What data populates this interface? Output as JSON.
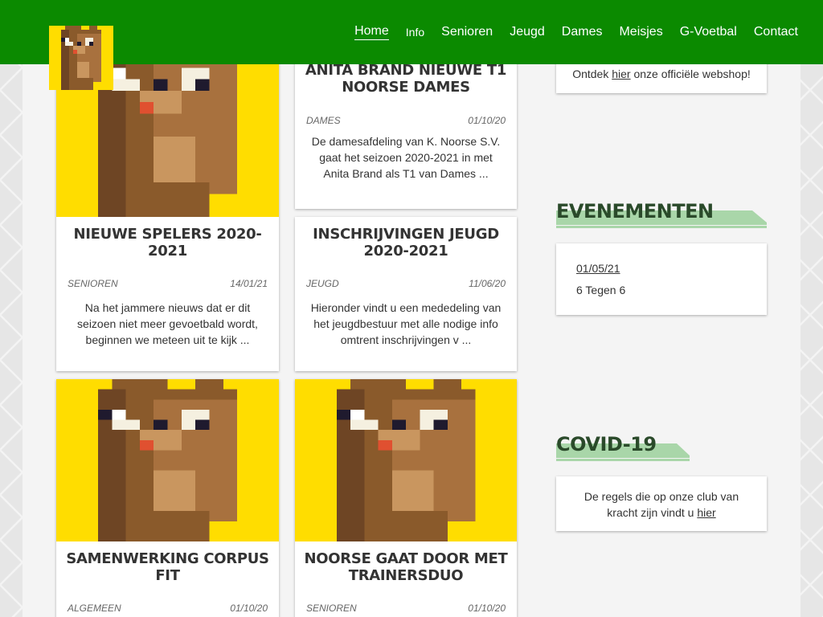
{
  "colors": {
    "header_bg": "#0b8a00",
    "logo_bg": "#ffdd00",
    "accent_underline": "#a9d6a9"
  },
  "nav": {
    "items": [
      {
        "label": "Home",
        "active": true
      },
      {
        "label": "Info"
      },
      {
        "label": "Senioren"
      },
      {
        "label": "Jeugd"
      },
      {
        "label": "Dames"
      },
      {
        "label": "Meisjes"
      },
      {
        "label": "G-Voetbal"
      },
      {
        "label": "Contact"
      }
    ]
  },
  "logo": {
    "icon": "pixel-beaver-logo"
  },
  "posts": [
    {
      "title": "ANITA BRAND NIEUWE T1 NOORSE DAMES",
      "category": "DAMES",
      "date": "01/10/20",
      "excerpt": "De damesafdeling van K. Noorse S.V. gaat het seizoen 2020-2021 in met Anita Brand als T1 van Dames ..."
    },
    {
      "title": "NIEUWE SPELERS 2020-2021",
      "category": "SENIOREN",
      "date": "14/01/21",
      "excerpt": "Na het jammere nieuws dat er dit seizoen niet meer gevoetbald wordt, beginnen we meteen uit te kijk ..."
    },
    {
      "title": "INSCHRIJVINGEN JEUGD 2020-2021",
      "category": "JEUGD",
      "date": "11/06/20",
      "excerpt": "Hieronder vindt u een mededeling van het jeugdbestuur met alle nodige info omtrent inschrijvingen v ..."
    },
    {
      "title": "SAMENWERKING CORPUS FIT",
      "category": "ALGEMEEN",
      "date": "01/10/20"
    },
    {
      "title": "NOORSE GAAT DOOR MET TRAINERSDUO",
      "category": "SENIOREN",
      "date": "01/10/20"
    }
  ],
  "sidebar": {
    "webshop": {
      "before": "Ontdek ",
      "link": "hier",
      "after": " onze officiële webshop!"
    },
    "events": {
      "title": "EVENEMENTEN",
      "items": [
        {
          "date": "01/05/21",
          "name": "6 Tegen 6"
        }
      ]
    },
    "covid": {
      "title": "COVID-19",
      "before": "De regels die op onze club van kracht zijn vindt u ",
      "link": "hier"
    }
  }
}
